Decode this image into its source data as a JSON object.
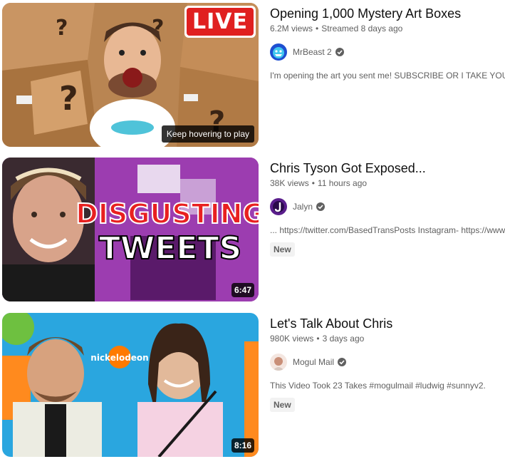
{
  "videos": [
    {
      "title": "Opening 1,000 Mystery Art Boxes",
      "views": "6.2M views",
      "age": "Streamed 8 days ago",
      "channel": "MrBeast 2",
      "description": "I'm opening the art you sent me! SUBSCRIBE OR I TAKE YOUR PIZZA",
      "live_label": "LIVE",
      "hover_hint": "Keep hovering to play",
      "verified": true
    },
    {
      "title": "Chris Tyson Got Exposed...",
      "views": "38K views",
      "age": "11 hours ago",
      "channel": "Jalyn",
      "description": "... https://twitter.com/BasedTransPosts Instagram- https://www",
      "badge": "New",
      "duration": "6:47",
      "thumb_text_1": "DISGUSTING",
      "thumb_text_2": "TWEETS",
      "verified": true
    },
    {
      "title": "Let's Talk About Chris",
      "views": "980K views",
      "age": "3 days ago",
      "channel": "Mogul Mail",
      "description": "This Video Took 23 Takes #mogulmail #ludwig #sunnyv2.",
      "badge": "New",
      "duration": "8:16",
      "thumb_logo": "nickelodeon",
      "verified": true
    }
  ],
  "separator": "•",
  "colors": {
    "live_red": "#e02020",
    "meta_gray": "#606060",
    "badge_bg": "#f2f2f2"
  }
}
